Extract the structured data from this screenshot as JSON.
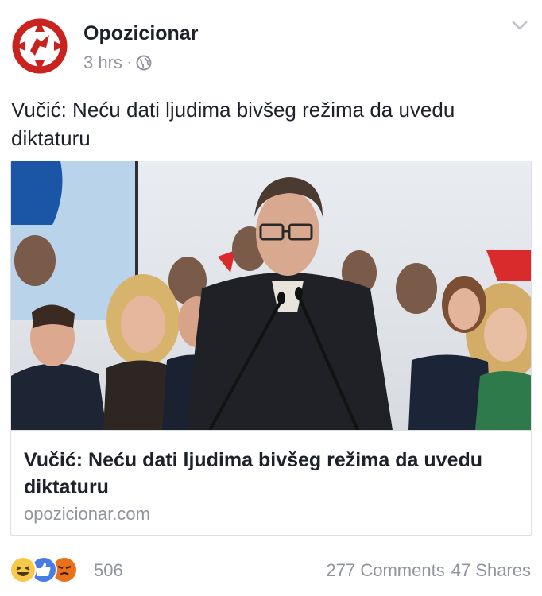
{
  "post": {
    "page_name": "Opozicionar",
    "time": "3 hrs",
    "separator": "·",
    "text": "Vučić: Neću dati ljudima bivšeg režima da uvedu diktaturu"
  },
  "link": {
    "title": "Vučić: Neću dati ljudima bivšeg režima da uvedu diktaturu",
    "domain": "opozicionar.com"
  },
  "engagement": {
    "reaction_icons": [
      "haha-icon",
      "like-icon",
      "angry-icon"
    ],
    "reaction_count": "506",
    "comments": "277 Comments",
    "shares": "47 Shares"
  },
  "colors": {
    "brand_red": "#c8231f",
    "meta_gray": "#90949c",
    "like_blue": "#4a7de2",
    "haha_yellow": "#f7c84a",
    "angry_orange": "#e9711c"
  }
}
